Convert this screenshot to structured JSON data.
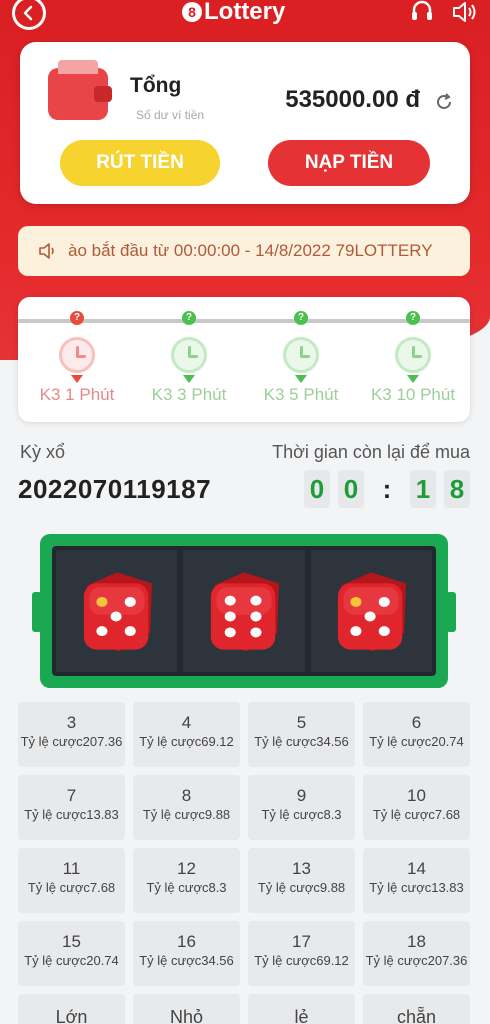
{
  "header": {
    "logo_mark": "8",
    "logo_text": "Lottery",
    "icons": [
      "back-arrow-icon",
      "headset-icon",
      "speaker-icon"
    ]
  },
  "wallet": {
    "title": "Tổng",
    "subtitle": "Số dư ví tiền",
    "balance": "535000.00 đ",
    "withdraw_label": "RÚT TIỀN",
    "deposit_label": "NẠP TIỀN"
  },
  "notice": {
    "text": "ào bắt đầu từ 00:00:00 - 14/8/2022 79LOTTERY"
  },
  "timers": [
    {
      "label": "K3 1 Phút",
      "active": true
    },
    {
      "label": "K3 3 Phút",
      "active": false
    },
    {
      "label": "K3 5 Phút",
      "active": false
    },
    {
      "label": "K3 10 Phút",
      "active": false
    }
  ],
  "draw": {
    "label": "Kỳ xổ",
    "id": "2022070119187",
    "remain_label": "Thời gian còn lại để mua",
    "digits": [
      "0",
      "0",
      "1",
      "8"
    ],
    "colon": ":"
  },
  "dice": [
    {
      "value": 5
    },
    {
      "value": 6
    },
    {
      "value": 5
    }
  ],
  "bets": [
    {
      "num": "3",
      "odds": "Tỷ lệ cược207.36"
    },
    {
      "num": "4",
      "odds": "Tỷ lệ cược69.12"
    },
    {
      "num": "5",
      "odds": "Tỷ lệ cược34.56"
    },
    {
      "num": "6",
      "odds": "Tỷ lệ cược20.74"
    },
    {
      "num": "7",
      "odds": "Tỷ lệ cược13.83"
    },
    {
      "num": "8",
      "odds": "Tỷ lệ cược9.88"
    },
    {
      "num": "9",
      "odds": "Tỷ lệ cược8.3"
    },
    {
      "num": "10",
      "odds": "Tỷ lệ cược7.68"
    },
    {
      "num": "11",
      "odds": "Tỷ lệ cược7.68"
    },
    {
      "num": "12",
      "odds": "Tỷ lệ cược8.3"
    },
    {
      "num": "13",
      "odds": "Tỷ lệ cược9.88"
    },
    {
      "num": "14",
      "odds": "Tỷ lệ cược13.83"
    },
    {
      "num": "15",
      "odds": "Tỷ lệ cược20.74"
    },
    {
      "num": "16",
      "odds": "Tỷ lệ cược34.56"
    },
    {
      "num": "17",
      "odds": "Tỷ lệ cược69.12"
    },
    {
      "num": "18",
      "odds": "Tỷ lệ cược207.36"
    }
  ],
  "sides": [
    "Lớn",
    "Nhỏ",
    "lẻ",
    "chẵn"
  ],
  "colors": {
    "brand_red": "#d91f22",
    "deposit_red": "#e53234",
    "withdraw_yellow": "#f6d32e",
    "countdown_green": "#1e9c3a",
    "dice_panel_green": "#1aa852"
  }
}
